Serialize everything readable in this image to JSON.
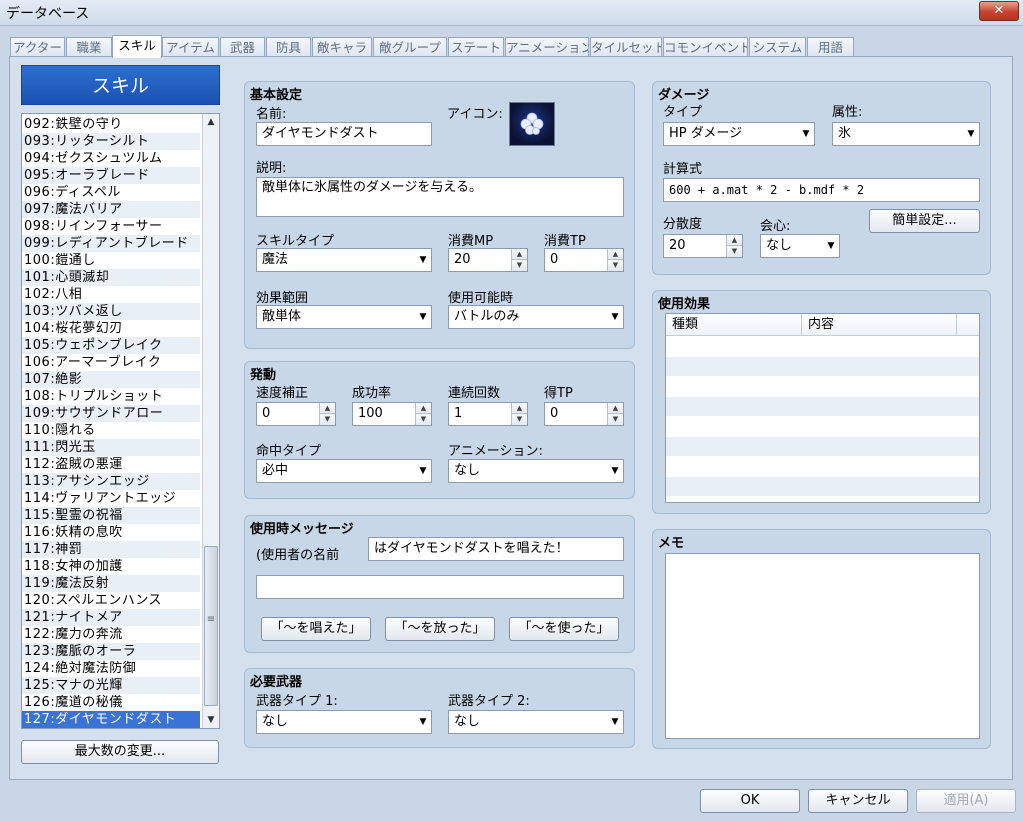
{
  "window": {
    "title": "データベース",
    "close_label": "✕"
  },
  "tabs": [
    "アクター",
    "職業",
    "スキル",
    "アイテム",
    "武器",
    "防具",
    "敵キャラ",
    "敵グループ",
    "ステート",
    "アニメーション",
    "タイルセット",
    "コモンイベント",
    "システム",
    "用語"
  ],
  "active_tab": 2,
  "list": {
    "header": "スキル",
    "items": [
      "092:鉄壁の守り",
      "093:リッターシルト",
      "094:ゼクスシュツルム",
      "095:オーラブレード",
      "096:ディスペル",
      "097:魔法バリア",
      "098:リインフォーサー",
      "099:レディアントブレード",
      "100:鎧通し",
      "101:心頭滅却",
      "102:八相",
      "103:ツバメ返し",
      "104:桜花夢幻刃",
      "105:ウェポンブレイク",
      "106:アーマーブレイク",
      "107:絶影",
      "108:トリプルショット",
      "109:サウザンドアロー",
      "110:隠れる",
      "111:閃光玉",
      "112:盗賊の悪運",
      "113:アサシンエッジ",
      "114:ヴァリアントエッジ",
      "115:聖霊の祝福",
      "116:妖精の息吹",
      "117:神罰",
      "118:女神の加護",
      "119:魔法反射",
      "120:スペルエンハンス",
      "121:ナイトメア",
      "122:魔力の奔流",
      "123:魔脈のオーラ",
      "124:絶対魔法防御",
      "125:マナの光輝",
      "126:魔道の秘儀",
      "127:ダイヤモンドダスト"
    ],
    "selected_index": 35,
    "change_max_label": "最大数の変更..."
  },
  "basic": {
    "title": "基本設定",
    "name_label": "名前:",
    "name_value": "ダイヤモンドダスト",
    "icon_label": "アイコン:",
    "desc_label": "説明:",
    "desc_value": "敵単体に氷属性のダメージを与える。",
    "skilltype_label": "スキルタイプ",
    "skilltype_value": "魔法",
    "mp_label": "消費MP",
    "mp_value": "20",
    "tp_label": "消費TP",
    "tp_value": "0",
    "scope_label": "効果範囲",
    "scope_value": "敵単体",
    "occasion_label": "使用可能時",
    "occasion_value": "バトルのみ"
  },
  "invocation": {
    "title": "発動",
    "speed_label": "速度補正",
    "speed_value": "0",
    "success_label": "成功率",
    "success_value": "100",
    "repeats_label": "連続回数",
    "repeats_value": "1",
    "tpgain_label": "得TP",
    "tpgain_value": "0",
    "hittype_label": "命中タイプ",
    "hittype_value": "必中",
    "animation_label": "アニメーション:",
    "animation_value": "なし"
  },
  "message": {
    "title": "使用時メッセージ",
    "prefix_label": "(使用者の名前",
    "line1_value": "はダイヤモンドダストを唱えた！",
    "line2_value": "",
    "btn_cast": "「～を唱えた」",
    "btn_release": "「～を放った」",
    "btn_use": "「～を使った」"
  },
  "weapons": {
    "title": "必要武器",
    "type1_label": "武器タイプ 1:",
    "type1_value": "なし",
    "type2_label": "武器タイプ 2:",
    "type2_value": "なし"
  },
  "damage": {
    "title": "ダメージ",
    "type_label": "タイプ",
    "type_value": "HP ダメージ",
    "element_label": "属性:",
    "element_value": "氷",
    "formula_label": "計算式",
    "formula_value": "600 + a.mat * 2 - b.mdf * 2",
    "variance_label": "分散度",
    "variance_value": "20",
    "critical_label": "会心:",
    "critical_value": "なし",
    "quick_setup_label": "簡単設定..."
  },
  "effects": {
    "title": "使用効果",
    "col_type": "種類",
    "col_content": "内容"
  },
  "note": {
    "title": "メモ",
    "value": ""
  },
  "footer": {
    "ok": "OK",
    "cancel": "キャンセル",
    "apply": "適用(A)"
  }
}
